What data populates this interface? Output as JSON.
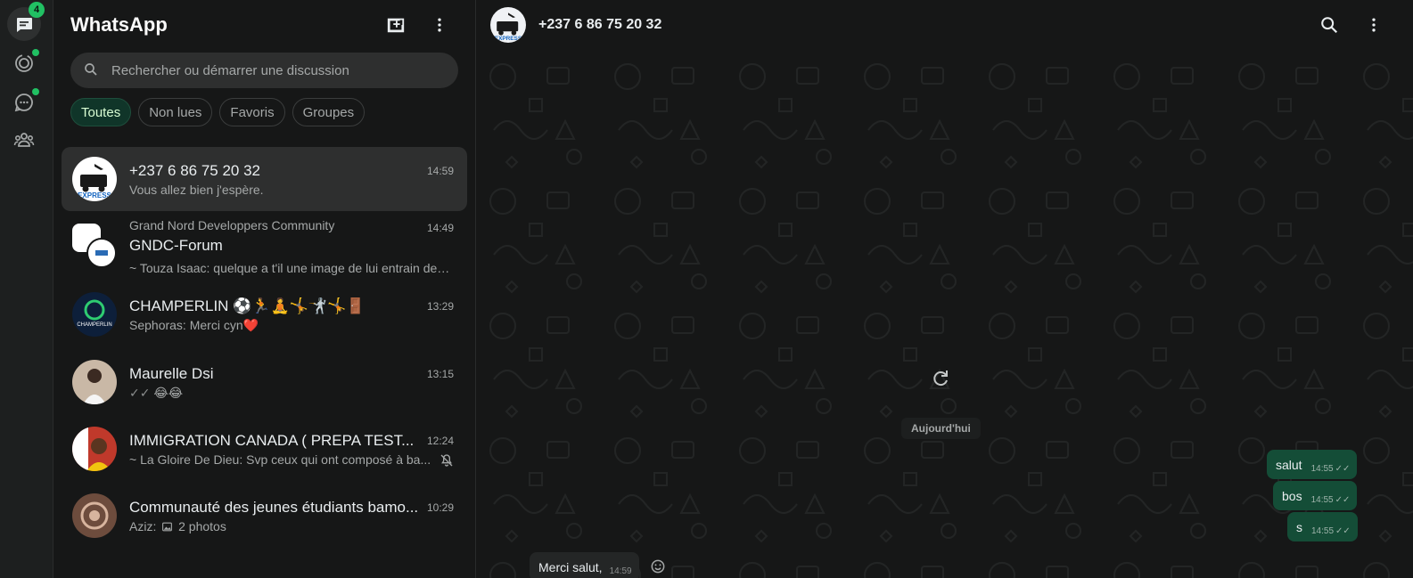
{
  "rail": {
    "chats_badge": "4"
  },
  "sidebar": {
    "title": "WhatsApp",
    "search_placeholder": "Rechercher ou démarrer une discussion",
    "filters": [
      "Toutes",
      "Non lues",
      "Favoris",
      "Groupes"
    ],
    "chats": [
      {
        "name": "+237 6 86 75 20 32",
        "time": "14:59",
        "message": "Vous allez bien j'espère."
      },
      {
        "community": "Grand Nord Developpers Community",
        "name": "GNDC-Forum",
        "time": "14:49",
        "message": "~ Touza Isaac: quelque a t'il une image de lui entrain de prog..."
      },
      {
        "name": "CHAMPERLIN ⚽🏃🧘🤸🤺🤸🚪",
        "time": "13:29",
        "message": "Sephoras: Merci cyn❤️"
      },
      {
        "name": "Maurelle Dsi",
        "time": "13:15",
        "message": "😂😂"
      },
      {
        "name": "IMMIGRATION CANADA ( PREPA TEST...",
        "time": "12:24",
        "message": "~ La Gloire De Dieu: Svp ceux qui ont composé à ba..."
      },
      {
        "name": "Communauté des jeunes étudiants bamo...",
        "time": "10:29",
        "message_prefix": "Aziz:",
        "message": "2 photos"
      }
    ]
  },
  "conversation": {
    "title": "+237 6 86 75 20 32",
    "date_separator": "Aujourd'hui",
    "messages_out": [
      {
        "text": "salut",
        "time": "14:55"
      },
      {
        "text": "bos",
        "time": "14:55"
      },
      {
        "text": "s",
        "time": "14:55"
      }
    ],
    "message_in": {
      "text": "Merci salut,",
      "time": "14:59"
    }
  },
  "colors": {
    "accent": "#21c063",
    "outgoing_bubble": "#144d37",
    "background": "#161717"
  }
}
